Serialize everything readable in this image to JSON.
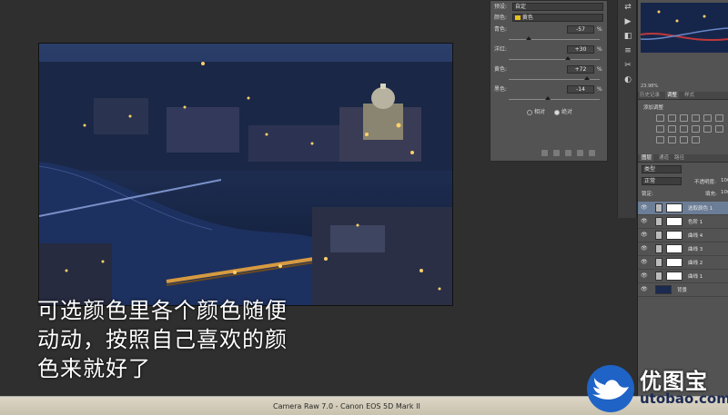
{
  "panel": {
    "preset_label": "预设:",
    "preset_value": "自定",
    "color_label": "颜色:",
    "color_value": "黄色",
    "sliders": [
      {
        "label": "青色:",
        "value": "-57",
        "pct": "%",
        "level": 0.215
      },
      {
        "label": "洋红:",
        "value": "+30",
        "pct": "%",
        "level": 0.65
      },
      {
        "label": "黄色:",
        "value": "+72",
        "pct": "%",
        "level": 0.86
      },
      {
        "label": "黑色:",
        "value": "-14",
        "pct": "%",
        "level": 0.43
      }
    ],
    "radio_relative": "相对",
    "radio_absolute": "绝对",
    "selected_mode": "绝对"
  },
  "tools": [
    "⇄",
    "▶",
    "◧",
    "≡",
    "✂",
    "◐"
  ],
  "right_panel": {
    "zoom": "23.98%",
    "tabs_hist": [
      "历史记录",
      "调整",
      "样式"
    ],
    "active_hist_tab": "调整",
    "add_adjustment": "添加调整",
    "layer_tabs": [
      "图层",
      "通道",
      "路径"
    ],
    "kind": "类型",
    "blend_mode": "正常",
    "opacity_label": "不透明度:",
    "opacity_value": "100",
    "lock_label": "锁定:",
    "fill_label": "填充:",
    "fill_value": "100",
    "layers": [
      {
        "name": "选取颜色 1",
        "selected": true
      },
      {
        "name": "色阶 1",
        "selected": false
      },
      {
        "name": "曲线 4",
        "selected": false
      },
      {
        "name": "曲线 3",
        "selected": false
      },
      {
        "name": "曲线 2",
        "selected": false
      },
      {
        "name": "曲线 1",
        "selected": false
      },
      {
        "name": "背景",
        "selected": false
      }
    ]
  },
  "caption": {
    "line1": "可选颜色里各个颜色随便",
    "line2": "动动，按照自己喜欢的颜",
    "line3": "色来就好了"
  },
  "status": "Camera Raw 7.0 -  Canon EOS 5D Mark II",
  "logo": {
    "cn": "优图宝",
    "url": "utobao.com"
  },
  "colors": {
    "accent_yellow": "#e8c020",
    "layer_selected": "#6b7d97",
    "bg": "#2f2f2f"
  }
}
